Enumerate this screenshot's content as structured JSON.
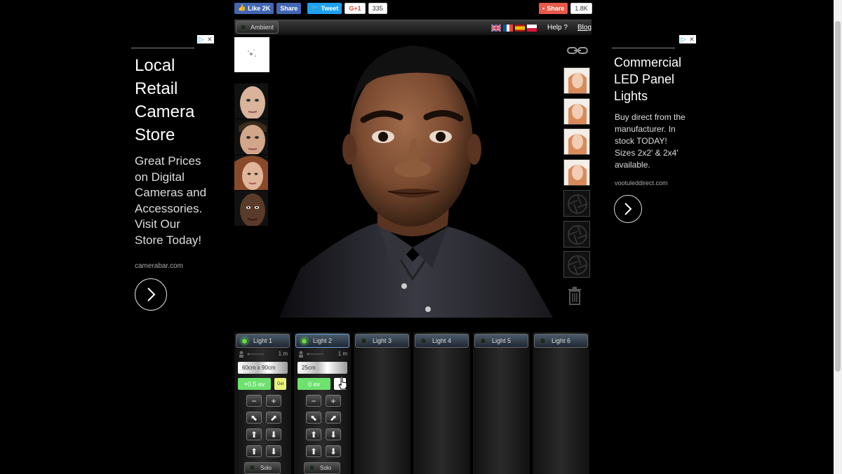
{
  "social": {
    "like_label": "Like 2K",
    "fb_share_label": "Share",
    "tweet_label": "Tweet",
    "gplus_label": "G+1",
    "gplus_count": "335",
    "share_label": "Share",
    "share_count": "1.8K"
  },
  "toolbar": {
    "ambient_label": "Ambient",
    "help_label": "Help ?",
    "blog_label": "Blog",
    "flags": [
      "uk-flag",
      "france-flag",
      "spain-flag",
      "poland-flag"
    ]
  },
  "ad_left": {
    "title": "Local Retail Camera Store",
    "body": "Great Prices on Digital Cameras and Accessories. Visit Our Store Today!",
    "domain": "camerabar.com"
  },
  "ad_right": {
    "title": "Commercial LED Panel Lights",
    "body": "Buy direct from the manufacturer. In stock TODAY! Sizes 2x2' & 2x4' available.",
    "domain": "vootuleddirect.com"
  },
  "lights": [
    {
      "label": "Light 1",
      "on": true,
      "distance": "1 m",
      "modifier": "60cm x 90cm",
      "ev": "+0.5 ev",
      "gel": "Gel"
    },
    {
      "label": "Light 2",
      "on": true,
      "distance": "1 m",
      "modifier": "25cm",
      "ev": "0 ev",
      "gel": ""
    },
    {
      "label": "Light 3",
      "on": false
    },
    {
      "label": "Light 4",
      "on": false
    },
    {
      "label": "Light 5",
      "on": false
    },
    {
      "label": "Light 6",
      "on": false
    }
  ],
  "controls": {
    "minus": "−",
    "plus": "+",
    "solo_label": "Solo"
  },
  "colors": {
    "background": "#000000",
    "ev_green": "#6de26d",
    "led_on": "#5fe03a",
    "facebook": "#4267b2",
    "twitter": "#1da1f2"
  }
}
